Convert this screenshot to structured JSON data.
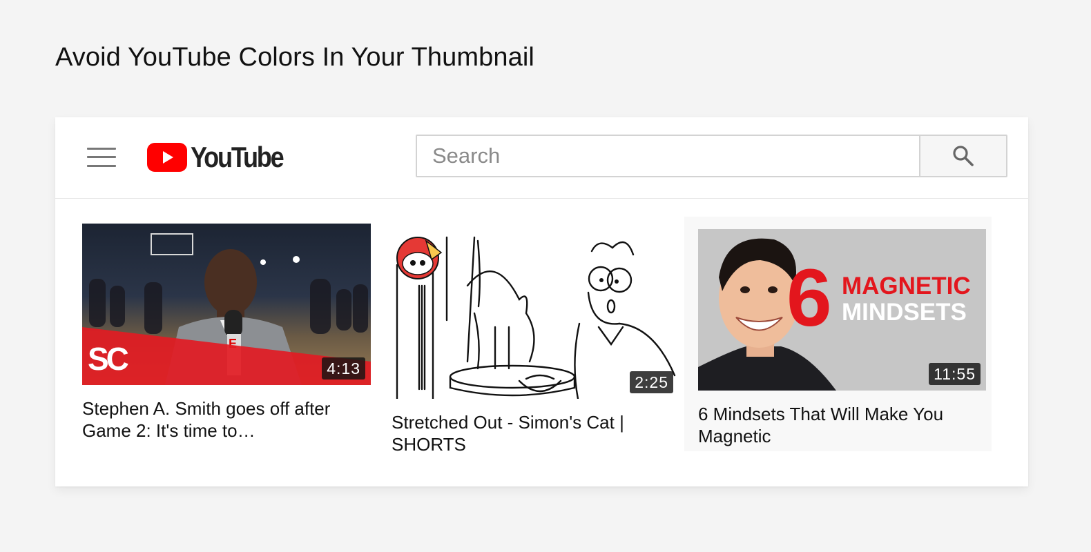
{
  "page": {
    "heading": "Avoid YouTube Colors In Your Thumbnail"
  },
  "header": {
    "menu_icon": "hamburger-icon",
    "logo_text": "YouTube",
    "logo_icon": "youtube-play-icon",
    "search_placeholder": "Search",
    "search_icon": "search-icon"
  },
  "colors": {
    "youtube_red": "#ff0000",
    "duration_badge": "#141414",
    "page_background": "#f4f4f4",
    "card_background": "#ffffff"
  },
  "videos": [
    {
      "title": "Stephen A. Smith goes off after Game 2: It's time to…",
      "duration": "4:13",
      "thumbnail_logo": "SC",
      "thumbnail_mic_letter": "E"
    },
    {
      "title": "Stretched Out - Simon's Cat | SHORTS",
      "duration": "2:25"
    },
    {
      "title": "6 Mindsets That Will Make You Magnetic",
      "duration": "11:55",
      "thumbnail_number": "6",
      "thumbnail_line1": "MAGNETIC",
      "thumbnail_line2": "MINDSETS"
    }
  ]
}
